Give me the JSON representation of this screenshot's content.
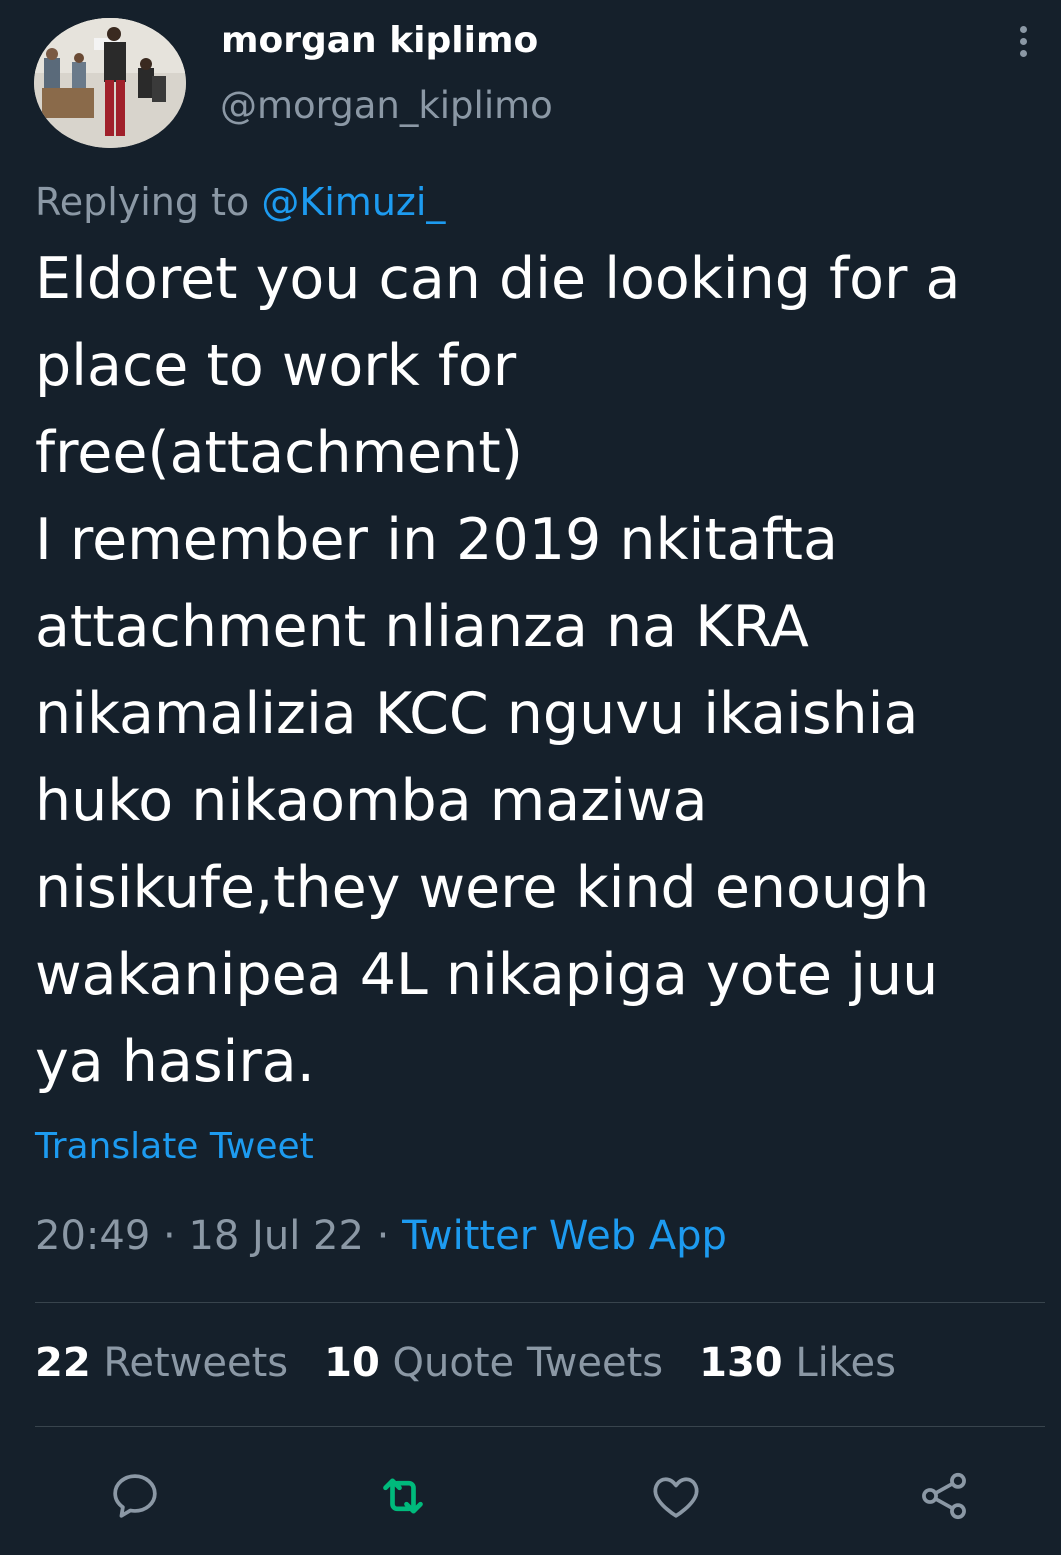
{
  "author": {
    "display_name": "morgan kiplimo",
    "handle": "@morgan_kiplimo"
  },
  "reply": {
    "prefix": "Replying to",
    "handle": "@Kimuzi_"
  },
  "tweet_lines": [
    "Eldoret you can die looking for a",
    "place to work for",
    "free(attachment)",
    "I remember in 2019 nkitafta",
    "attachment nlianza na KRA",
    "nikamalizia KCC nguvu ikaishia",
    "huko nikaomba maziwa",
    "nisikufe,they were kind enough",
    "wakanipea 4L nikapiga yote juu",
    "ya hasira."
  ],
  "translate_label": "Translate Tweet",
  "meta": {
    "time": "20:49",
    "sep": " · ",
    "date": "18 Jul 22",
    "source": "Twitter Web App"
  },
  "stats": {
    "retweets_count": "22",
    "retweets_label": "Retweets",
    "quotes_count": "10",
    "quotes_label": "Quote Tweets",
    "likes_count": "130",
    "likes_label": "Likes"
  },
  "colors": {
    "background": "#15202b",
    "accent": "#1d9bf0",
    "secondary_text": "#8b98a5",
    "retweet_green": "#00ba7c"
  },
  "icons": [
    "more-icon",
    "reply-icon",
    "retweet-icon",
    "like-icon",
    "share-icon"
  ]
}
